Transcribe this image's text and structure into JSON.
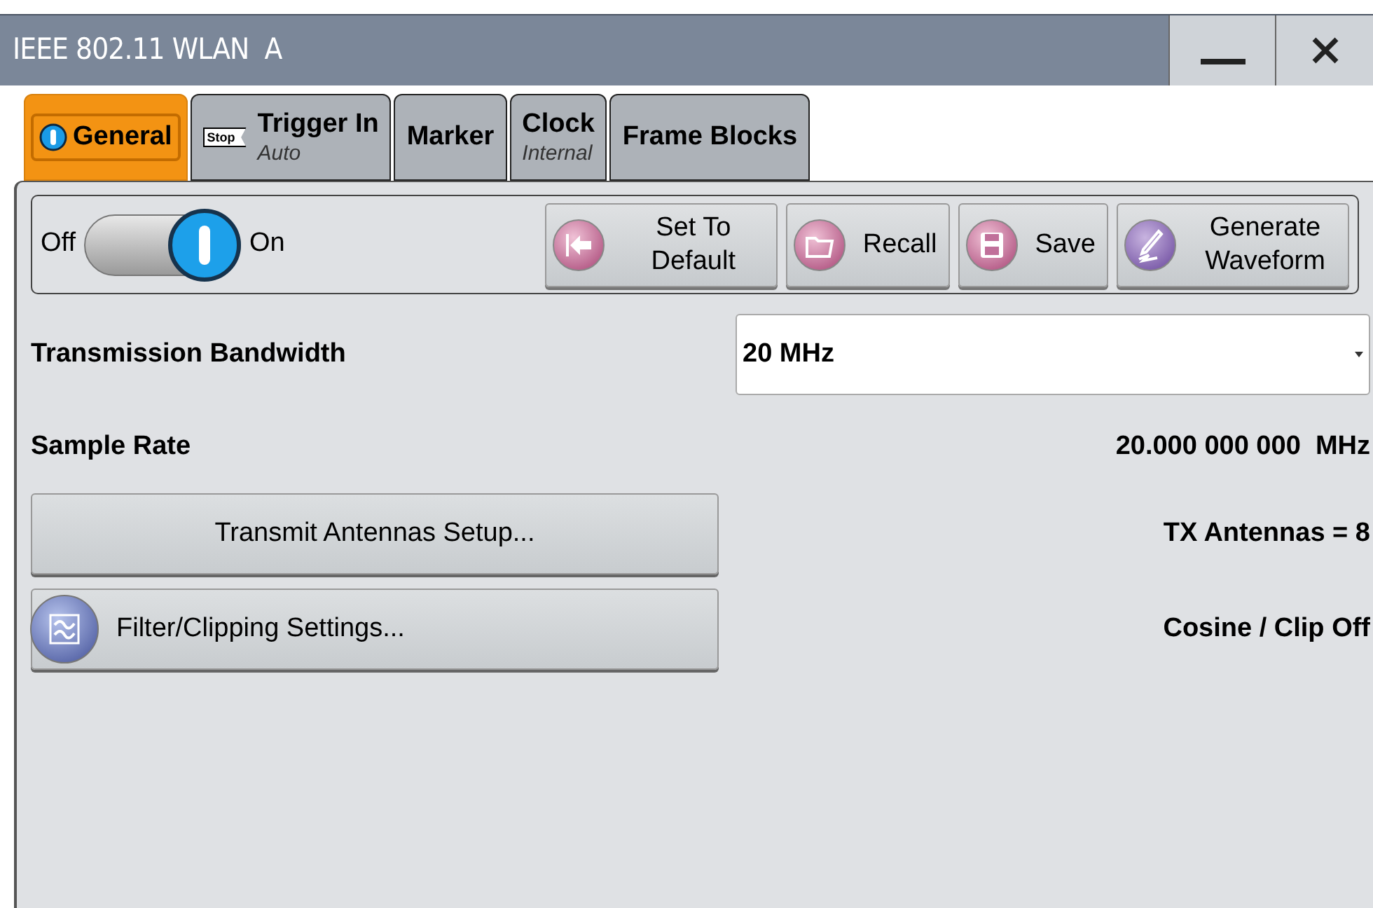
{
  "window": {
    "title": "IEEE 802.11 WLAN  A",
    "controls": [
      {
        "kind": "minimize"
      },
      {
        "kind": "close"
      }
    ]
  },
  "tabs": [
    {
      "label": "General",
      "kind": "info",
      "selected": true
    },
    {
      "label": "Trigger In",
      "sublabel": "Auto",
      "kind": "badge",
      "badge": "Stop",
      "selected": false
    },
    {
      "label": "Marker",
      "kind": "plain",
      "selected": false
    },
    {
      "label": "Clock",
      "sublabel": "Internal",
      "kind": "plain",
      "selected": false
    },
    {
      "label": "Frame Blocks",
      "kind": "plain",
      "selected": false
    }
  ],
  "toolbar": {
    "off_label": "Off",
    "on_label": "On",
    "on": true,
    "buttons": [
      {
        "label": "Set To Default",
        "kind": "default"
      },
      {
        "label": "Recall",
        "kind": "recall"
      },
      {
        "label": "Save",
        "kind": "save"
      },
      {
        "label": "Generate Waveform",
        "kind": "generate"
      }
    ]
  },
  "transmission_bandwidth": {
    "label": "Transmission Bandwidth",
    "value": "20 MHz"
  },
  "sample_rate": {
    "label": "Sample Rate",
    "value": "20.000 000 000  MHz"
  },
  "actions": [
    {
      "label": "Transmit Antennas Setup...",
      "kind": "plain",
      "status": "TX Antennas = 8"
    },
    {
      "label": "Filter/Clipping Settings...",
      "kind": "filter",
      "status": "Cosine / Clip Off"
    }
  ]
}
